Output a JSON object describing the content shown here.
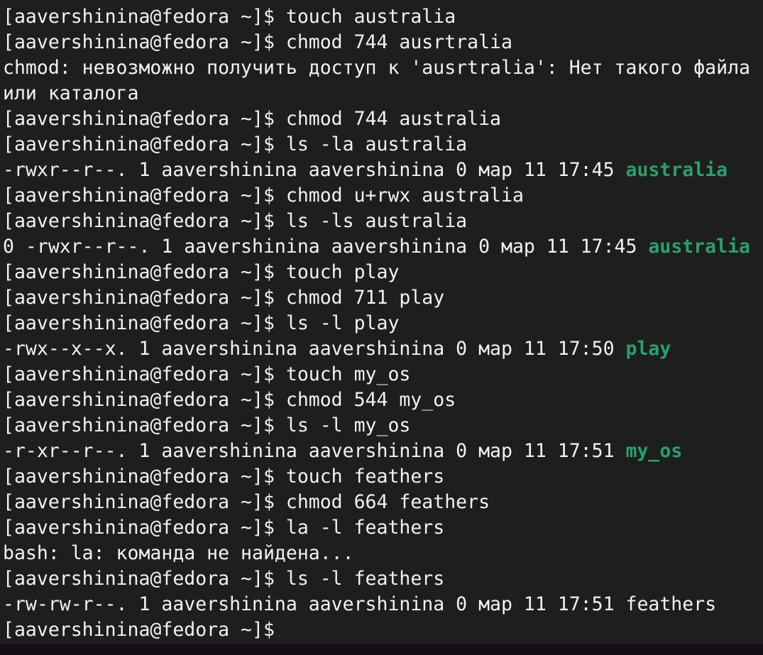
{
  "terminal": {
    "accent_color": "#26a269",
    "lines": [
      [
        {
          "t": "[aavershinina@fedora ~]$ touch australia"
        }
      ],
      [
        {
          "t": "[aavershinina@fedora ~]$ chmod 744 ausrtralia"
        }
      ],
      [
        {
          "t": "chmod: невозможно получить доступ к 'ausrtralia': Нет такого файла"
        }
      ],
      [
        {
          "t": "или каталога"
        }
      ],
      [
        {
          "t": "[aavershinina@fedora ~]$ chmod 744 australia"
        }
      ],
      [
        {
          "t": "[aavershinina@fedora ~]$ ls -la australia"
        }
      ],
      [
        {
          "t": "-rwxr--r--. 1 aavershinina aavershinina 0 мар 11 17:45 "
        },
        {
          "t": "australia",
          "g": true
        }
      ],
      [
        {
          "t": "[aavershinina@fedora ~]$ chmod u+rwx australia"
        }
      ],
      [
        {
          "t": "[aavershinina@fedora ~]$ ls -ls australia"
        }
      ],
      [
        {
          "t": "0 -rwxr--r--. 1 aavershinina aavershinina 0 мар 11 17:45 "
        },
        {
          "t": "australia",
          "g": true
        }
      ],
      [
        {
          "t": "[aavershinina@fedora ~]$ touch play"
        }
      ],
      [
        {
          "t": "[aavershinina@fedora ~]$ chmod 711 play"
        }
      ],
      [
        {
          "t": "[aavershinina@fedora ~]$ ls -l play"
        }
      ],
      [
        {
          "t": "-rwx--x--x. 1 aavershinina aavershinina 0 мар 11 17:50 "
        },
        {
          "t": "play",
          "g": true
        }
      ],
      [
        {
          "t": "[aavershinina@fedora ~]$ touch my_os"
        }
      ],
      [
        {
          "t": "[aavershinina@fedora ~]$ chmod 544 my_os"
        }
      ],
      [
        {
          "t": "[aavershinina@fedora ~]$ ls -l my_os"
        }
      ],
      [
        {
          "t": "-r-xr--r--. 1 aavershinina aavershinina 0 мар 11 17:51 "
        },
        {
          "t": "my_os",
          "g": true
        }
      ],
      [
        {
          "t": "[aavershinina@fedora ~]$ touch feathers"
        }
      ],
      [
        {
          "t": "[aavershinina@fedora ~]$ chmod 664 feathers"
        }
      ],
      [
        {
          "t": "[aavershinina@fedora ~]$ la -l feathers"
        }
      ],
      [
        {
          "t": "bash: la: команда не найдена..."
        }
      ],
      [
        {
          "t": "[aavershinina@fedora ~]$ ls -l feathers"
        }
      ],
      [
        {
          "t": "-rw-rw-r--. 1 aavershinina aavershinina 0 мар 11 17:51 feathers"
        }
      ],
      [
        {
          "t": "[aavershinina@fedora ~]$"
        }
      ]
    ]
  }
}
